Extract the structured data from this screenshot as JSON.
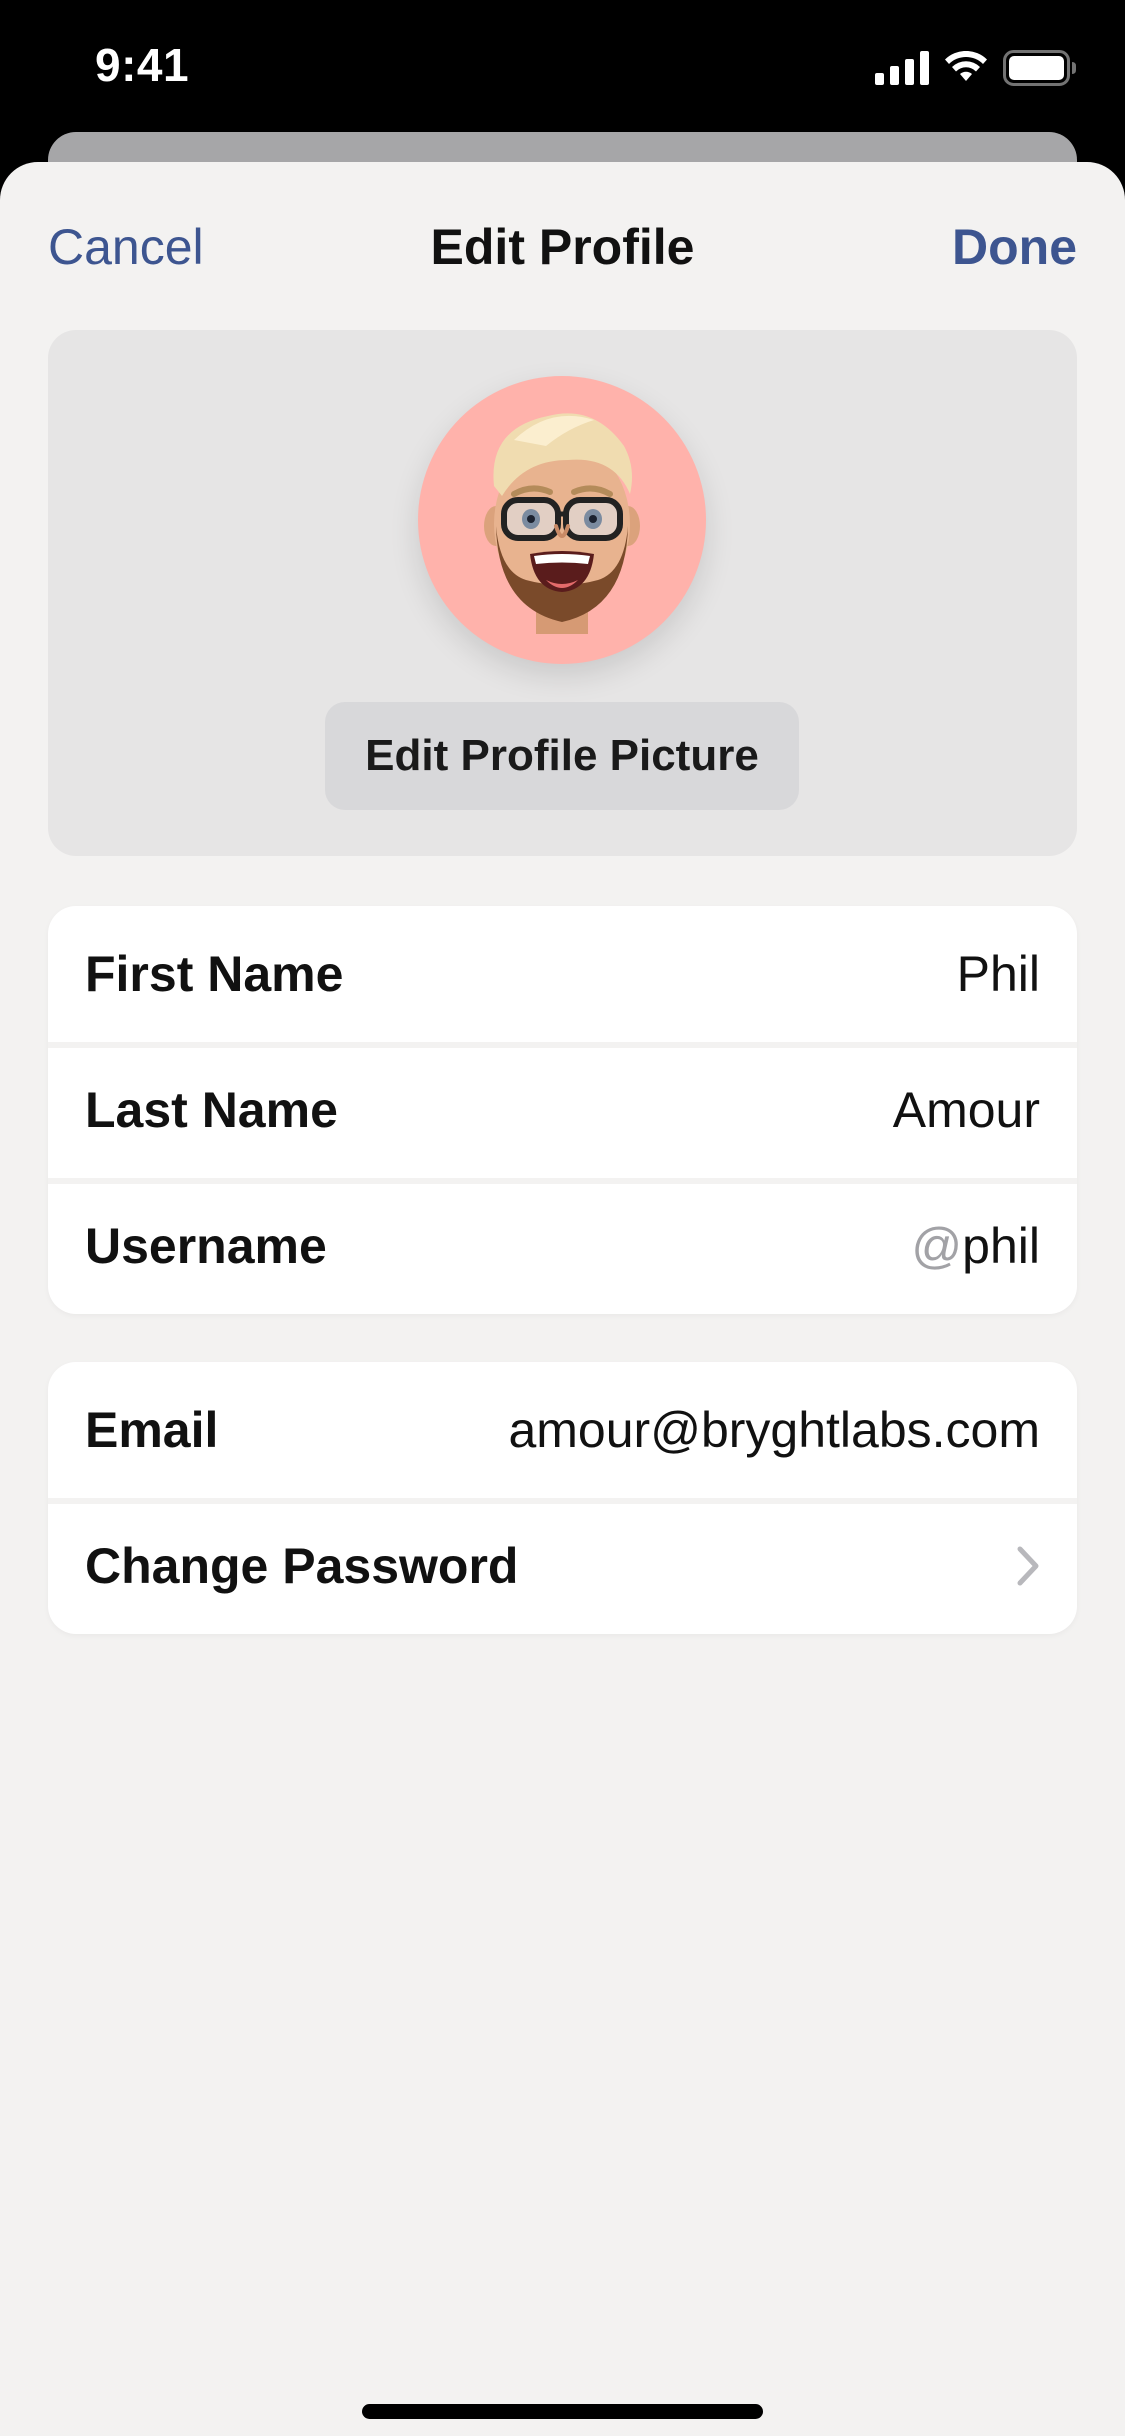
{
  "status_bar": {
    "time": "9:41",
    "icons": [
      "cellular-signal-icon",
      "wifi-icon",
      "battery-icon"
    ]
  },
  "nav": {
    "cancel_label": "Cancel",
    "title": "Edit Profile",
    "done_label": "Done"
  },
  "profile": {
    "avatar": "memoji-avatar",
    "avatar_bg": "#ffb2ab",
    "edit_picture_label": "Edit Profile Picture"
  },
  "fields": {
    "first_name": {
      "label": "First Name",
      "value": "Phil"
    },
    "last_name": {
      "label": "Last Name",
      "value": "Amour"
    },
    "username": {
      "label": "Username",
      "prefix": "@",
      "value": "phil"
    }
  },
  "account": {
    "email": {
      "label": "Email",
      "value": "amour@bryghtlabs.com"
    },
    "change_password": {
      "label": "Change Password",
      "icon": "chevron-right-icon"
    }
  },
  "colors": {
    "accent": "#3d5590",
    "sheet_bg": "#f3f2f1",
    "panel_bg": "#e6e5e5",
    "button_bg": "#d8d8da"
  }
}
